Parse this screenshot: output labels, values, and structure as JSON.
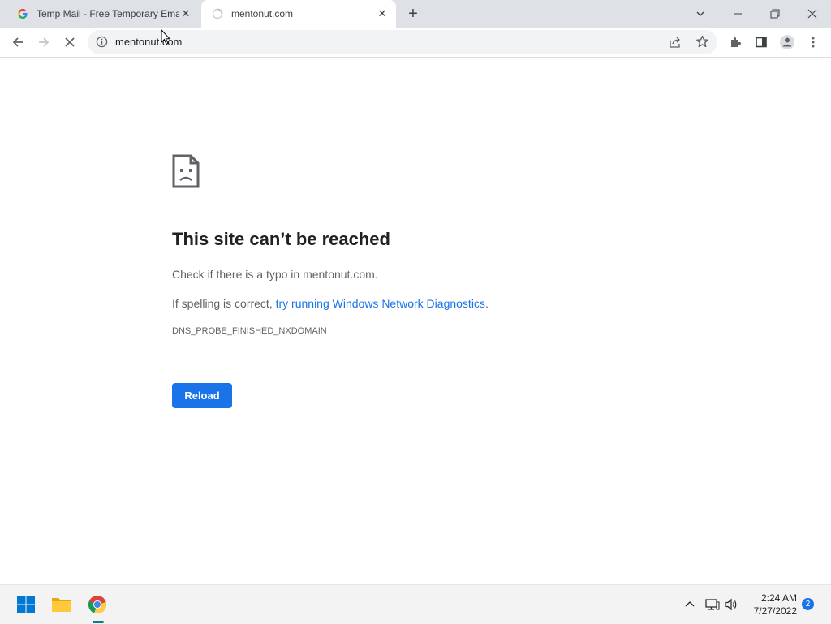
{
  "tabs": [
    {
      "title": "Temp Mail - Free Temporary Ema",
      "active": false,
      "favicon": "google-icon"
    },
    {
      "title": "mentonut.com",
      "active": true,
      "favicon": "loading-spinner-icon"
    }
  ],
  "omnibox": {
    "url": "mentonut.com"
  },
  "error": {
    "headline": "This site can’t be reached",
    "line1": "Check if there is a typo in mentonut.com.",
    "line2_prefix": "If spelling is correct, ",
    "line2_link": "try running Windows Network Diagnostics",
    "line2_suffix": ".",
    "code": "DNS_PROBE_FINISHED_NXDOMAIN",
    "reload_label": "Reload"
  },
  "taskbar": {
    "time": "2:24 AM",
    "date": "7/27/2022",
    "notification_count": "2"
  },
  "colors": {
    "accent": "#1a73e8",
    "tabstrip": "#dee1e6"
  }
}
